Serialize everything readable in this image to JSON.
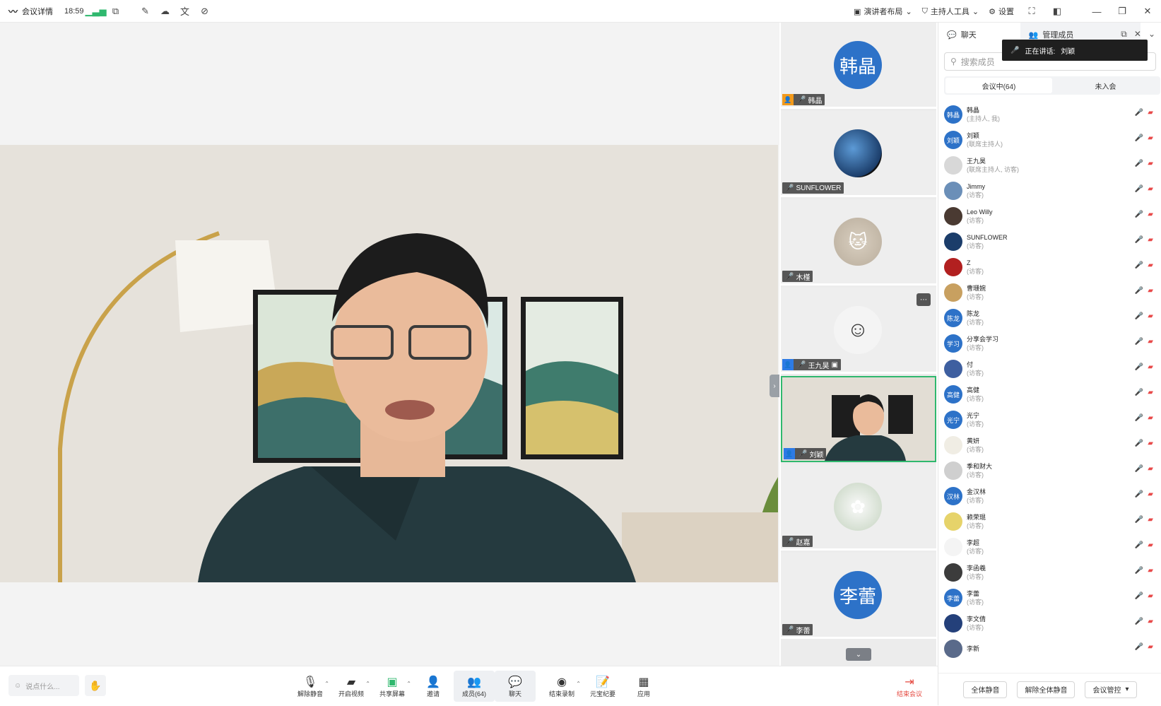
{
  "topbar": {
    "meeting_details": "会议详情",
    "time": "18:59",
    "right": {
      "speaker_layout": "演讲者布局",
      "host_tools": "主持人工具",
      "settings": "设置"
    }
  },
  "gallery": [
    {
      "name": "韩晶",
      "avatar_text": "韩晶",
      "color": "#2d72c8",
      "host": "orange"
    },
    {
      "name": "SUNFLOWER",
      "avatar_text": "",
      "color": "#1b3d6a"
    },
    {
      "name": "木槿",
      "avatar_text": "",
      "color": "#c9c3b8"
    },
    {
      "name": "王九昊",
      "avatar_text": "",
      "color": "#f1f1f1",
      "host": "blue"
    },
    {
      "name": "刘颖",
      "avatar_text": "",
      "color": "#cfc9bf",
      "host": "blue",
      "active": true
    },
    {
      "name": "赵嘉",
      "avatar_text": "",
      "color": "#dfe6dc"
    },
    {
      "name": "李蕾",
      "avatar_text": "李蕾",
      "color": "#2d72c8"
    }
  ],
  "panel": {
    "tab_chat": "聊天",
    "tab_members": "管理成员",
    "speaking_label": "正在讲话:",
    "speaking_name": "刘颖",
    "search_placeholder": "搜索成员",
    "seg_in_meeting": "会议中(64)",
    "seg_not_joined": "未入会",
    "members": [
      {
        "name": "韩晶",
        "role": "(主持人, 我)",
        "av": "韩晶",
        "color": "#2d72c8"
      },
      {
        "name": "刘颖",
        "role": "(联席主持人)",
        "av": "刘颖",
        "color": "#2d72c8"
      },
      {
        "name": "王九昊",
        "role": "(联席主持人, 访客)",
        "av": "",
        "color": "#d8d8d8"
      },
      {
        "name": "Jimmy",
        "role": "(访客)",
        "av": "",
        "color": "#6b8fb8"
      },
      {
        "name": "Leo Willy",
        "role": "(访客)",
        "av": "",
        "color": "#4a3a32"
      },
      {
        "name": "SUNFLOWER",
        "role": "(访客)",
        "av": "",
        "color": "#1b3d6a"
      },
      {
        "name": "Z",
        "role": "(访客)",
        "av": "",
        "color": "#b22020"
      },
      {
        "name": "曹珊婉",
        "role": "(访客)",
        "av": "",
        "color": "#c8a060"
      },
      {
        "name": "陈龙",
        "role": "(访客)",
        "av": "陈龙",
        "color": "#2d72c8"
      },
      {
        "name": "分享会学习",
        "role": "(访客)",
        "av": "学习",
        "color": "#2d72c8"
      },
      {
        "name": "付",
        "role": "(访客)",
        "av": "",
        "color": "#3e5fa0"
      },
      {
        "name": "高健",
        "role": "(访客)",
        "av": "高健",
        "color": "#2d72c8"
      },
      {
        "name": "光宁",
        "role": "(访客)",
        "av": "光宁",
        "color": "#2d72c8"
      },
      {
        "name": "黄妍",
        "role": "(访客)",
        "av": "",
        "color": "#f0ede4"
      },
      {
        "name": "季和财大",
        "role": "(访客)",
        "av": "",
        "color": "#cfcfcf"
      },
      {
        "name": "金汉林",
        "role": "(访客)",
        "av": "汉林",
        "color": "#2d72c8"
      },
      {
        "name": "赖荣琨",
        "role": "(访客)",
        "av": "",
        "color": "#e6d36a"
      },
      {
        "name": "李超",
        "role": "(访客)",
        "av": "",
        "color": "#f4f4f4"
      },
      {
        "name": "李函羲",
        "role": "(访客)",
        "av": "",
        "color": "#3c3c3c"
      },
      {
        "name": "李蕾",
        "role": "(访客)",
        "av": "李蕾",
        "color": "#2d72c8"
      },
      {
        "name": "李文倩",
        "role": "(访客)",
        "av": "",
        "color": "#24407a"
      },
      {
        "name": "李新",
        "role": "",
        "av": "",
        "color": "#5a6a8a"
      }
    ],
    "mute_all": "全体静音",
    "unmute_all": "解除全体静音",
    "meeting_control": "会议管控"
  },
  "toolbar": {
    "chat_placeholder": "说点什么...",
    "unmute": "解除静音",
    "start_video": "开启视频",
    "share_screen": "共享屏幕",
    "invite": "邀请",
    "members": "成员(64)",
    "chat": "聊天",
    "end_recording": "结束录制",
    "yuanbao_minutes": "元宝纪要",
    "apps": "应用",
    "end_meeting": "结束会议"
  },
  "colors": {
    "accent": "#2d72c8",
    "danger": "#e5483f",
    "active_border": "#2fb86e"
  }
}
